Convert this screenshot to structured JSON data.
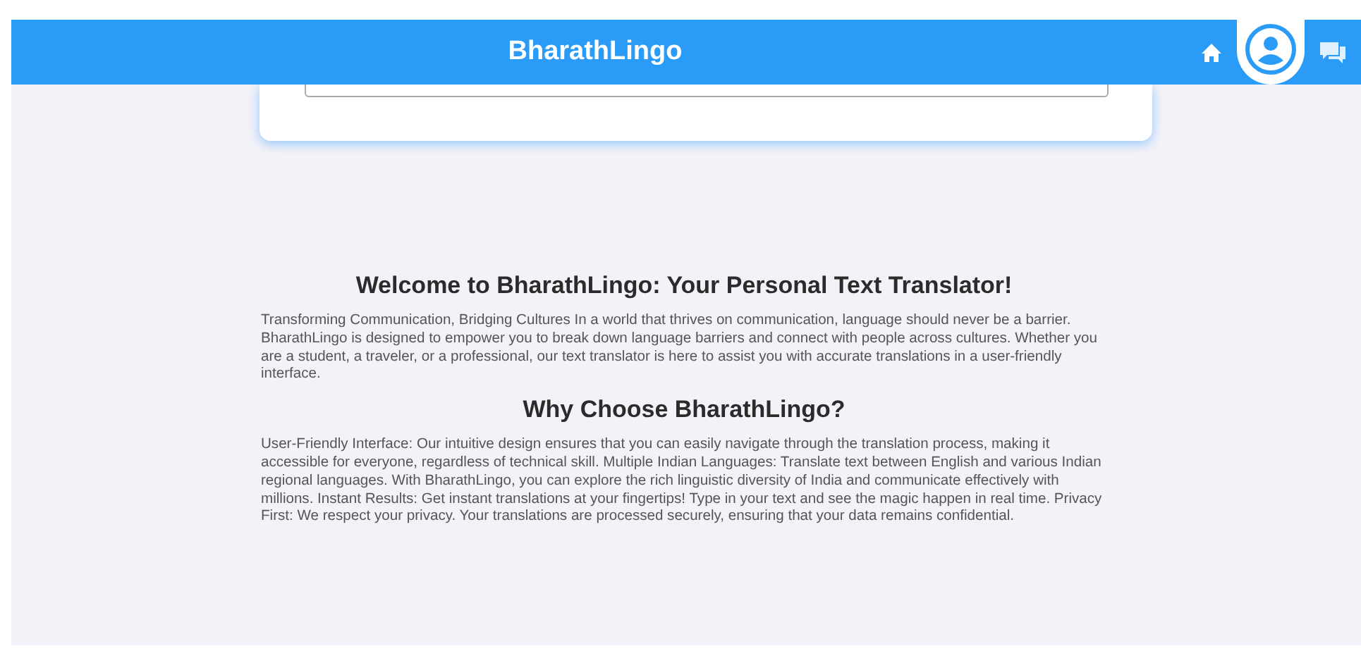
{
  "header": {
    "title": "BharathLingo"
  },
  "sections": [
    {
      "heading": "Welcome to BharathLingo: Your Personal Text Translator!",
      "body": "Transforming Communication, Bridging Cultures In a world that thrives on communication, language should never be a barrier. BharathLingo is designed to empower you to break down language barriers and connect with people across cultures. Whether you are a student, a traveler, or a professional, our text translator is here to assist you with accurate translations in a user-friendly interface."
    },
    {
      "heading": "Why Choose BharathLingo?",
      "body": "User-Friendly Interface: Our intuitive design ensures that you can easily navigate through the translation process, making it accessible for everyone, regardless of technical skill. Multiple Indian Languages: Translate text between English and various Indian regional languages. With BharathLingo, you can explore the rich linguistic diversity of India and communicate effectively with millions. Instant Results: Get instant translations at your fingertips! Type in your text and see the magic happen in real time. Privacy First: We respect your privacy. Your translations are processed securely, ensuring that your data remains confidential."
    }
  ]
}
